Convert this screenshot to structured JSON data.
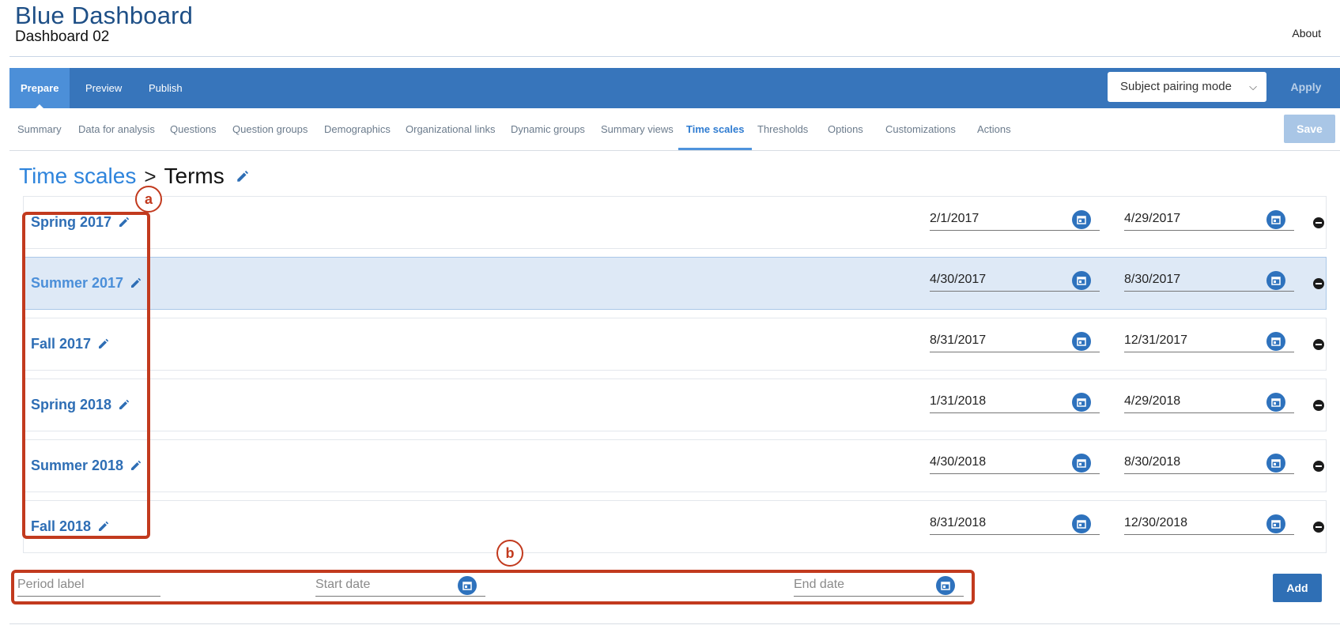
{
  "header": {
    "title": "Blue Dashboard",
    "subtitle": "Dashboard 02",
    "about": "About"
  },
  "navbar": {
    "tabs": [
      {
        "label": "Prepare",
        "active": true
      },
      {
        "label": "Preview",
        "active": false
      },
      {
        "label": "Publish",
        "active": false
      }
    ],
    "mode_select": "Subject pairing mode",
    "apply": "Apply"
  },
  "subnav": {
    "items": [
      {
        "label": "Summary"
      },
      {
        "label": "Data for analysis"
      },
      {
        "label": "Questions"
      },
      {
        "label": "Question groups"
      },
      {
        "label": "Demographics"
      },
      {
        "label": "Organizational links"
      },
      {
        "label": "Dynamic groups"
      },
      {
        "label": "Summary views"
      },
      {
        "label": "Time scales",
        "active": true
      },
      {
        "label": "Thresholds"
      },
      {
        "label": "Options"
      },
      {
        "label": "Customizations"
      },
      {
        "label": "Actions"
      }
    ],
    "save": "Save"
  },
  "breadcrumb": {
    "parent": "Time scales",
    "separator": ">",
    "current": "Terms"
  },
  "terms": [
    {
      "label": "Spring 2017",
      "start": "2/1/2017",
      "end": "4/29/2017"
    },
    {
      "label": "Summer 2017",
      "start": "4/30/2017",
      "end": "8/30/2017",
      "highlighted": true
    },
    {
      "label": "Fall 2017",
      "start": "8/31/2017",
      "end": "12/31/2017"
    },
    {
      "label": "Spring 2018",
      "start": "1/31/2018",
      "end": "4/29/2018"
    },
    {
      "label": "Summer 2018",
      "start": "4/30/2018",
      "end": "8/30/2018"
    },
    {
      "label": "Fall 2018",
      "start": "8/31/2018",
      "end": "12/30/2018"
    }
  ],
  "new_period": {
    "label_placeholder": "Period label",
    "start_placeholder": "Start date",
    "end_placeholder": "End date",
    "add": "Add"
  },
  "annotations": {
    "a": "a",
    "b": "b",
    "color": "#c23a1e"
  },
  "colors": {
    "navbar": "#3775bb",
    "accent": "#2e84dc",
    "highlight_row": "#dee9f6"
  }
}
